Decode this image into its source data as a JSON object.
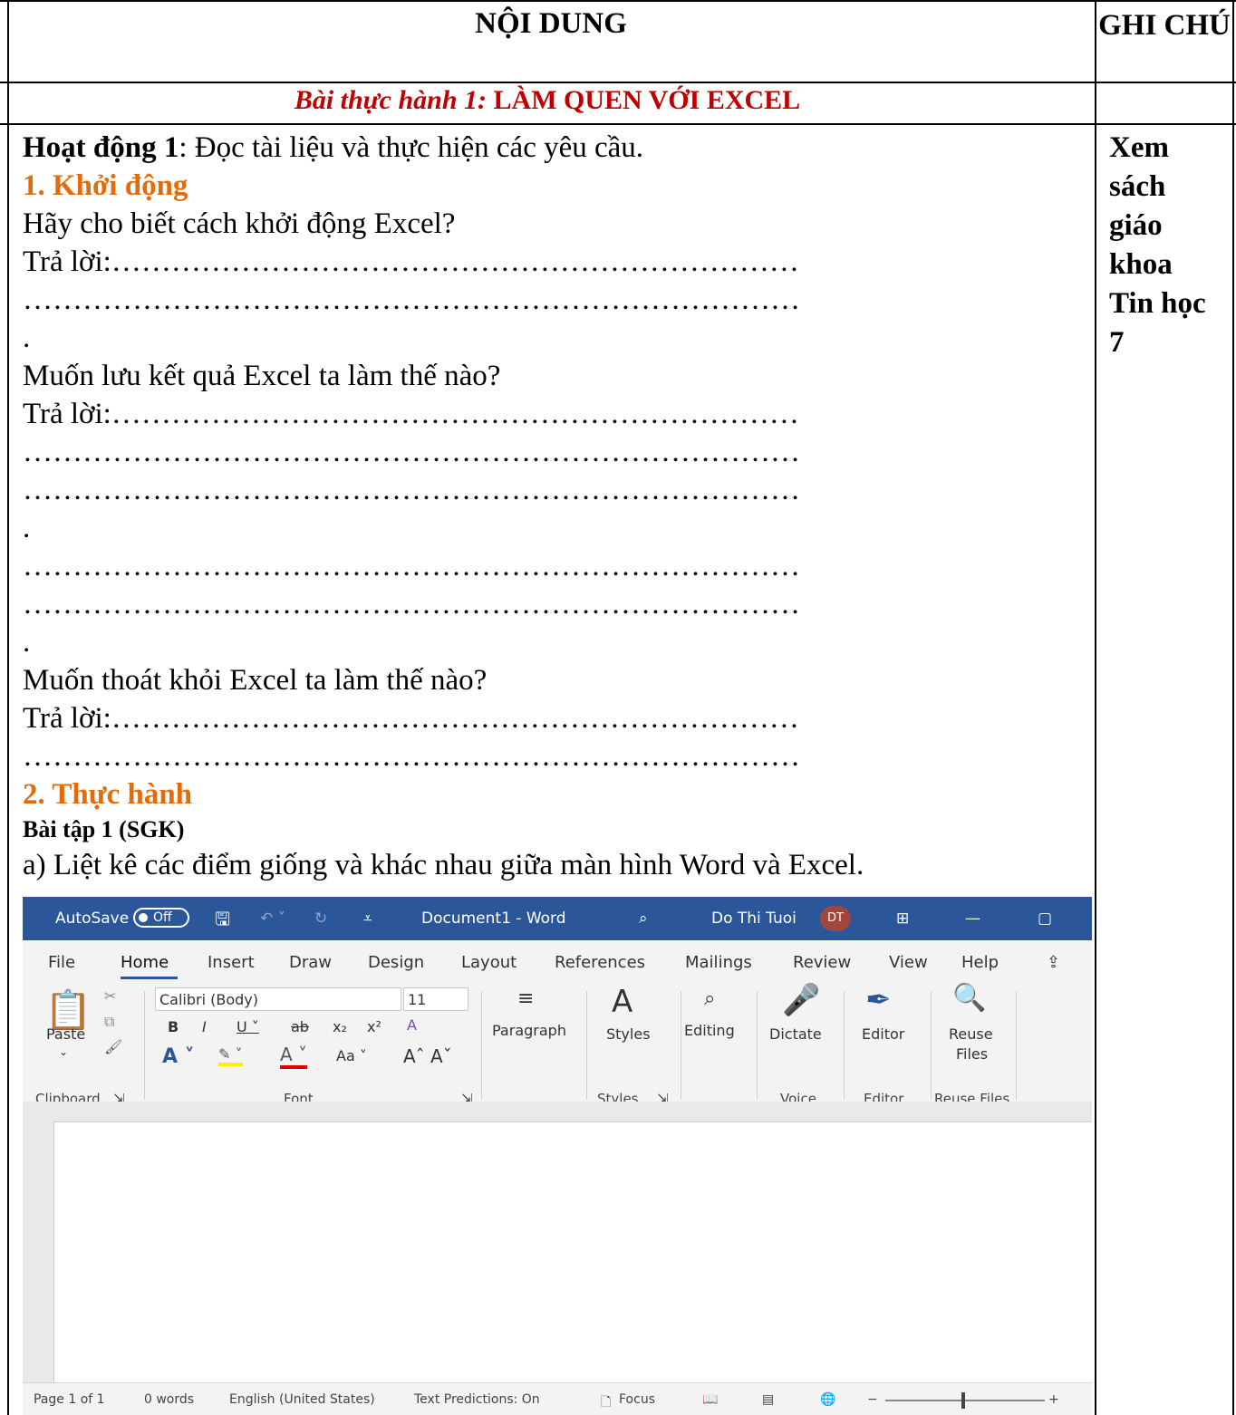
{
  "table": {
    "col1_header": "NỘI DUNG",
    "col2_header": "GHI CHÚ",
    "lesson_prefix": "Bài thực hành 1:",
    "lesson_title": "LÀM QUEN VỚI EXCEL"
  },
  "content": {
    "activity_label": "Hoạt động 1",
    "activity_text": ": Đọc tài liệu và thực hiện các yêu cầu.",
    "section1": "1. Khởi động",
    "q1": "Hãy cho biết cách khởi động Excel?",
    "answer_label": "Trả lời:……………………………………………………………",
    "dots_line": "……………………………………………………………………",
    "dot": ".",
    "q2": "Muốn lưu kết quả Excel ta làm thế nào?",
    "q3": "Muốn thoát khỏi Excel ta làm thế nào?",
    "section2": "2. Thực hành",
    "exercise": "Bài tập 1 (SGK)",
    "item_a": "a) Liệt kê các điểm giống và khác nhau giữa màn hình Word và Excel."
  },
  "note": {
    "lines": [
      "Xem",
      "sách",
      "giáo",
      "khoa",
      "Tin học",
      "7"
    ]
  },
  "word": {
    "autosave": "AutoSave",
    "autosave_state": "Off",
    "doc_title": "Document1 - Word",
    "user": "Do Thi Tuoi",
    "user_initials": "DT",
    "tabs": [
      "File",
      "Home",
      "Insert",
      "Draw",
      "Design",
      "Layout",
      "References",
      "Mailings",
      "Review",
      "View",
      "Help"
    ],
    "font_name": "Calibri (Body)",
    "font_size": "11",
    "paste": "Paste",
    "paragraph": "Paragraph",
    "styles": "Styles",
    "editing": "Editing",
    "dictate": "Dictate",
    "editor": "Editor",
    "reuse": "Reuse",
    "files": "Files",
    "groups": {
      "clipboard": "Clipboard",
      "font": "Font",
      "styles": "Styles",
      "voice": "Voice",
      "editor": "Editor",
      "reuse_files": "Reuse Files"
    },
    "status": {
      "page": "Page 1 of 1",
      "words": "0 words",
      "language": "English (United States)",
      "predictions": "Text Predictions: On",
      "focus": "Focus"
    }
  }
}
